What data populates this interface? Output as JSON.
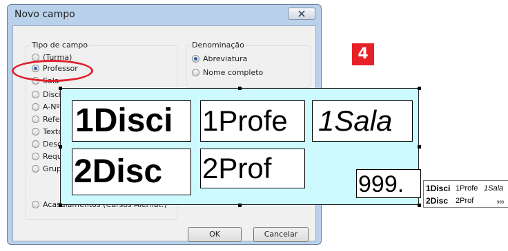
{
  "dialog": {
    "title": "Novo campo",
    "close_label": "X",
    "tipo_group": {
      "legend": "Tipo de campo",
      "options": [
        {
          "label": "(Turma)",
          "checked": false
        },
        {
          "label": "Professor",
          "checked": true
        },
        {
          "label": "Sala",
          "checked": false
        },
        {
          "label": "Discip",
          "checked": false
        },
        {
          "label": "A-Nº.",
          "checked": false
        },
        {
          "label": "Refer",
          "checked": false
        },
        {
          "label": "Texto",
          "checked": false
        },
        {
          "label": "Desc",
          "checked": false
        },
        {
          "label": "Requ",
          "checked": false
        },
        {
          "label": "Grupo",
          "checked": false
        }
      ],
      "extra_option": {
        "label": "Acasalamentos (Cursos Alernat.)",
        "checked": false
      }
    },
    "denominacao_group": {
      "legend": "Denominação",
      "options": [
        {
          "label": "Abreviatura",
          "checked": true
        },
        {
          "label": "Nome completo",
          "checked": false
        }
      ]
    },
    "ok_label": "OK",
    "cancel_label": "Cancelar"
  },
  "step_badge": "4",
  "highlight_color": "#e0202c",
  "preview": {
    "background": "#ccfaff",
    "cells": {
      "disc1": "1Disci",
      "prof1": "1Profe",
      "sala1": "1Sala",
      "disc2": "2Disc",
      "prof2": "2Prof",
      "num": "999."
    }
  },
  "mini_preview": {
    "disc1": "1Disci",
    "prof1": "1Profe",
    "sala1": "1Sala",
    "disc2": "2Disc",
    "prof2": "2Prof",
    "num": "999"
  }
}
